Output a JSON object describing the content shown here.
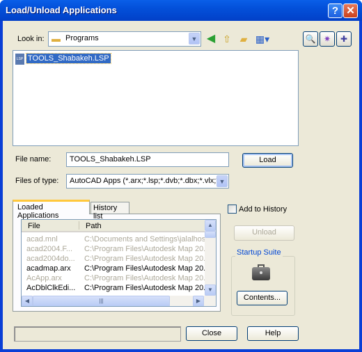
{
  "window": {
    "title": "Load/Unload Applications",
    "help_icon": "?",
    "close_icon": "✕"
  },
  "look_in": {
    "label": "Look in:",
    "value": "Programs"
  },
  "toolbar": {
    "icons": [
      "back-icon",
      "up-folder-icon",
      "new-folder-icon",
      "views-menu-icon"
    ],
    "right_icons": [
      "find-icon",
      "tools-icon",
      "add-icon"
    ]
  },
  "file_list": [
    {
      "name": "TOOLS_Shabakeh.LSP",
      "icon_text": "LSP",
      "selected": true
    }
  ],
  "file_name": {
    "label": "File name:",
    "value": "TOOLS_Shabakeh.LSP"
  },
  "file_type": {
    "label": "Files of type:",
    "value": "AutoCAD Apps (*.arx;*.lsp;*.dvb;*.dbx;*.vlx;*."
  },
  "load_label": "Load",
  "tabs": [
    {
      "label": "Loaded Applications",
      "active": true
    },
    {
      "label": "History list",
      "active": false
    }
  ],
  "loaded": {
    "columns": [
      "File",
      "Path"
    ],
    "rows": [
      {
        "file": "acad.mnl",
        "path": "C:\\Documents and Settings\\jalalhos",
        "dim": true
      },
      {
        "file": "acad2004.F...",
        "path": "C:\\Program Files\\Autodesk Map 20...",
        "dim": true
      },
      {
        "file": "acad2004do...",
        "path": "C:\\Program Files\\Autodesk Map 20...",
        "dim": true
      },
      {
        "file": "acadmap.arx",
        "path": "C:\\Program Files\\Autodesk Map 20...",
        "dim": false
      },
      {
        "file": "AcApp.arx",
        "path": "C:\\Program Files\\Autodesk Map 20...",
        "dim": true
      },
      {
        "file": "AcDblClkEdi...",
        "path": "C:\\Program Files\\Autodesk Map 20...",
        "dim": false
      }
    ]
  },
  "add_to_history": {
    "label": "Add to History",
    "checked": false
  },
  "unload_label": "Unload",
  "startup_suite": {
    "title": "Startup Suite",
    "contents_label": "Contents..."
  },
  "status_text": "",
  "close_label": "Close",
  "help_label": "Help",
  "colors": {
    "title_bar": "#0350d9",
    "face": "#ece9d8",
    "group_title": "#0046d5",
    "selection": "#316ac5"
  }
}
